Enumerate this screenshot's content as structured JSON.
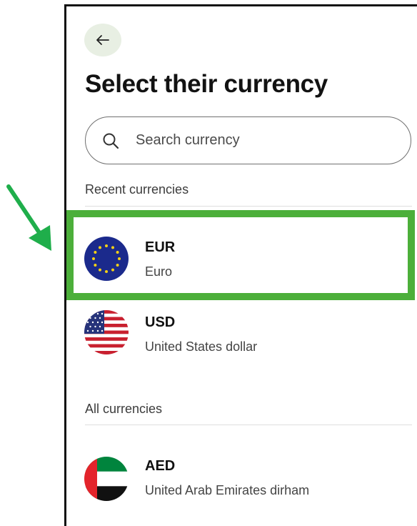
{
  "page": {
    "title": "Select their currency",
    "back_icon": "arrow-left-icon"
  },
  "search": {
    "placeholder": "Search currency",
    "value": "",
    "icon": "search-icon"
  },
  "sections": {
    "recent_label": "Recent currencies",
    "all_label": "All currencies"
  },
  "recent_currencies": [
    {
      "code": "EUR",
      "name": "Euro",
      "flag_icon": "eu-flag-icon"
    },
    {
      "code": "USD",
      "name": "United States dollar",
      "flag_icon": "us-flag-icon"
    }
  ],
  "all_currencies": [
    {
      "code": "AED",
      "name": "United Arab Emirates dirham",
      "flag_icon": "uae-flag-icon"
    }
  ],
  "annotation": {
    "highlight_color": "#4caf3a",
    "arrow_color": "#1fae4b",
    "highlighted_item": "EUR"
  },
  "colors": {
    "back_button_bg": "#e8efe3"
  }
}
